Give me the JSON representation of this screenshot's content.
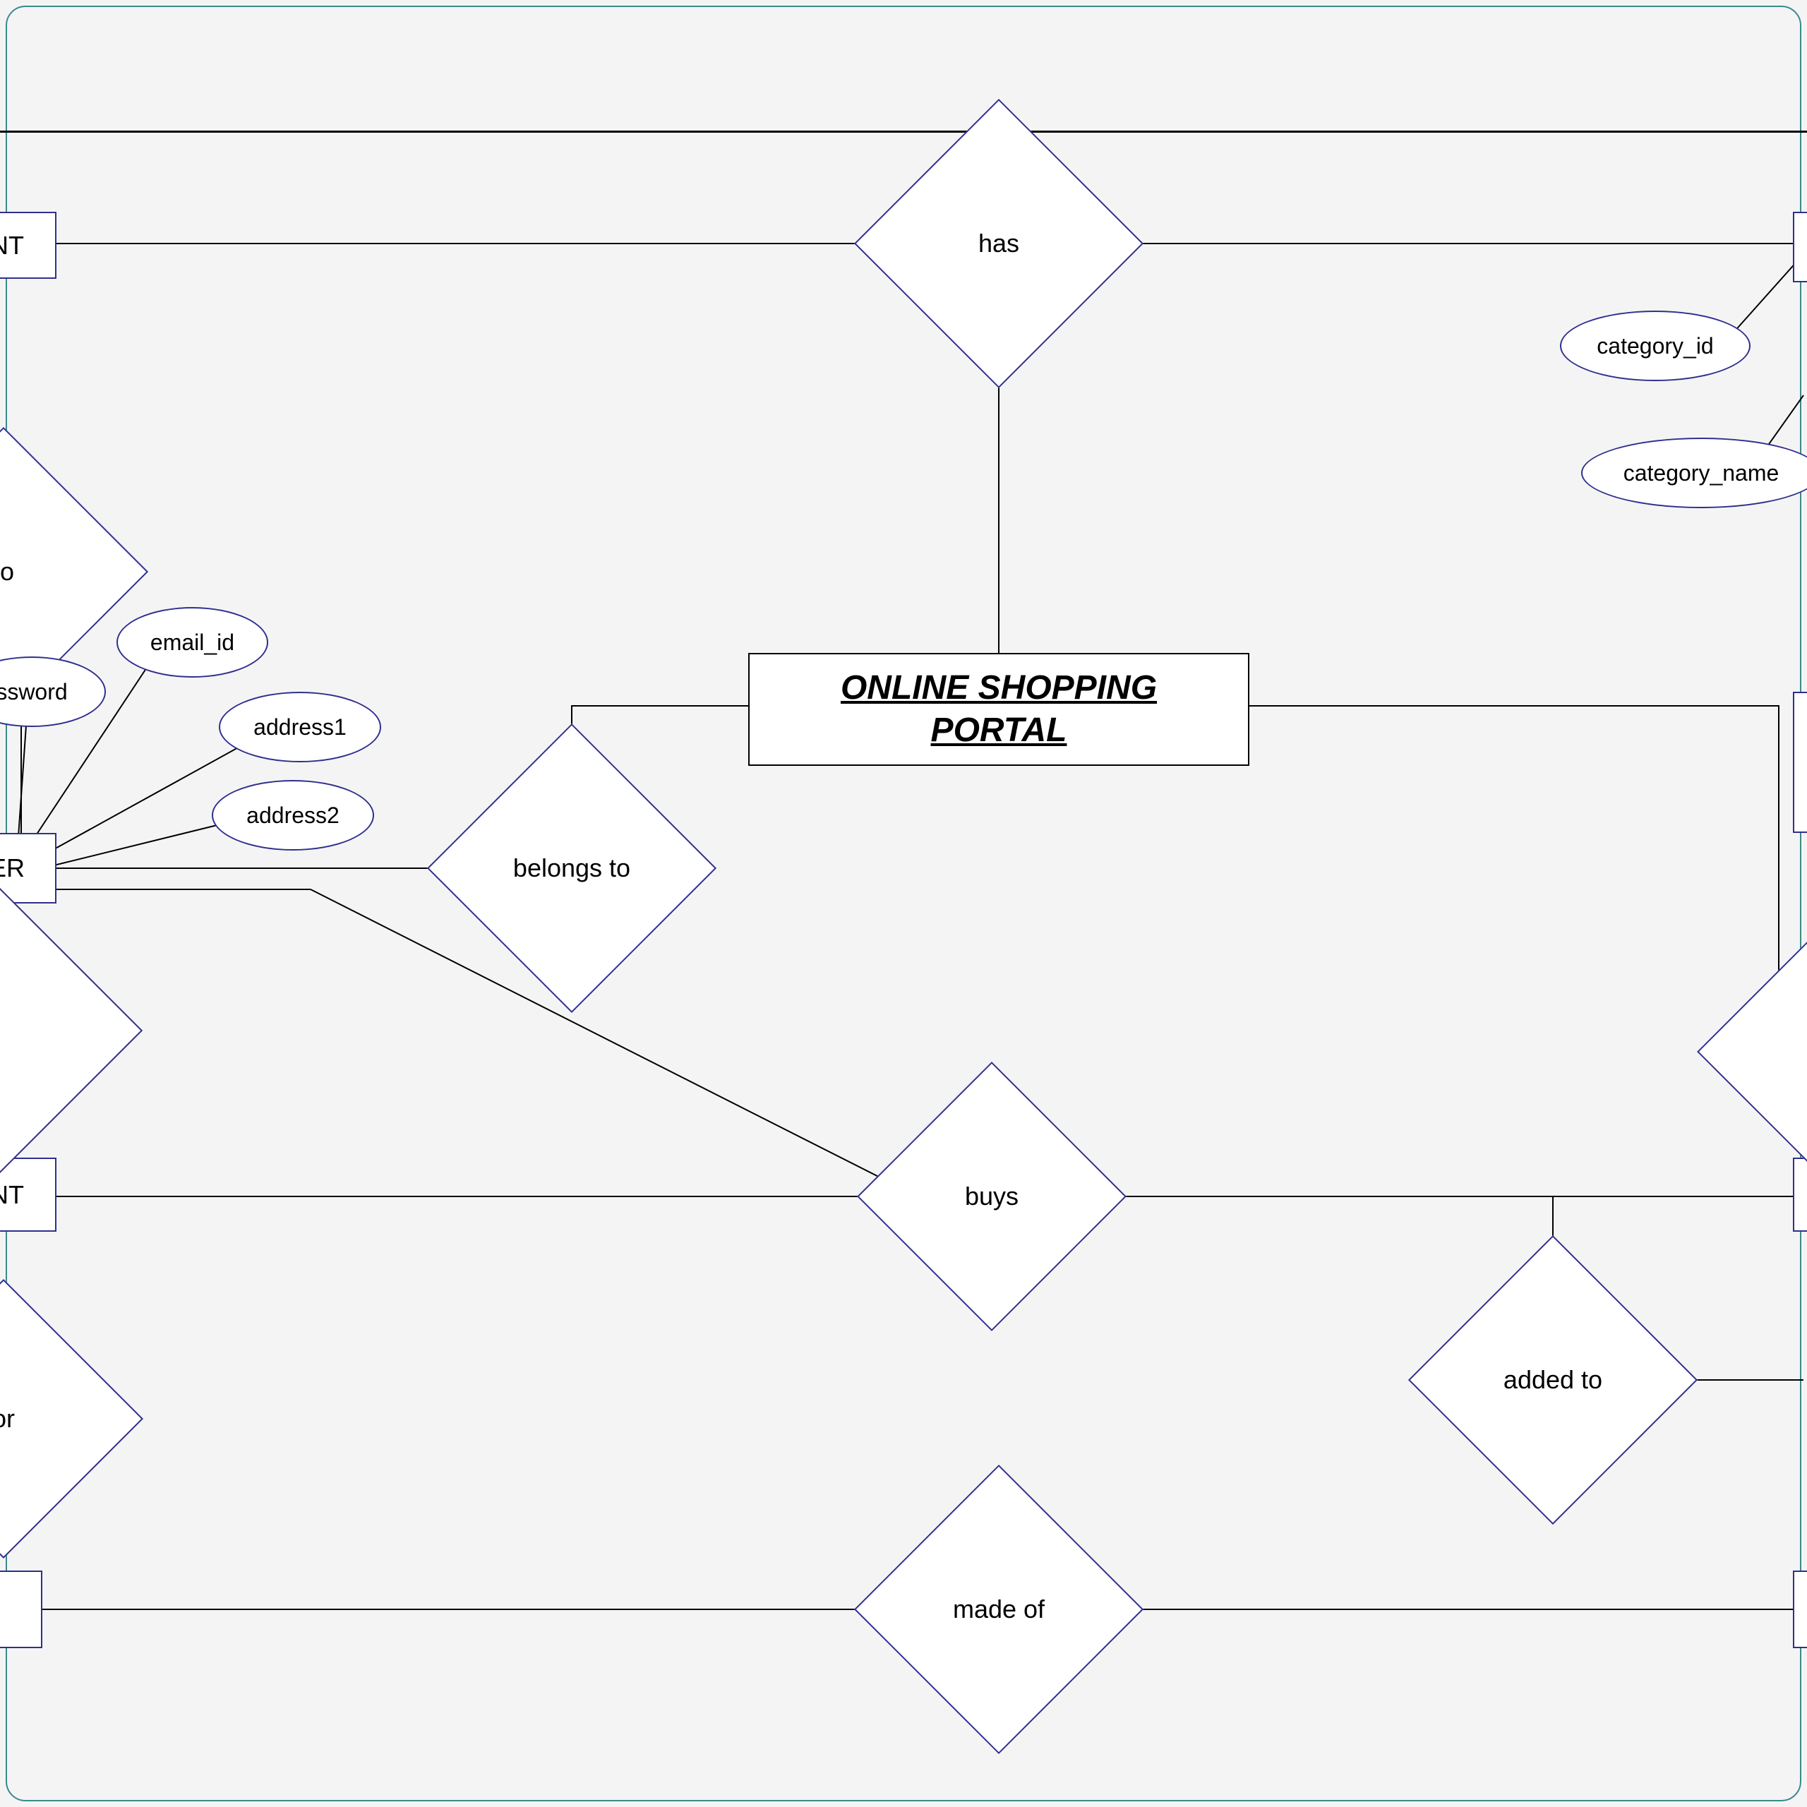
{
  "title": "ONLINE SHOPPING\nPORTAL",
  "entities": {
    "top_left": "NT",
    "user": "ER",
    "left_mid": "NT"
  },
  "relationships": {
    "has": "has",
    "to": "to",
    "belongs_to": "belongs to",
    "buys": "buys",
    "added_to": "added to",
    "made_of": "made of",
    "or": "or"
  },
  "attributes": {
    "category_id": "category_id",
    "category_name": "category_name",
    "password": "ssword",
    "email_id": "email_id",
    "address1": "address1",
    "address2": "address2"
  }
}
